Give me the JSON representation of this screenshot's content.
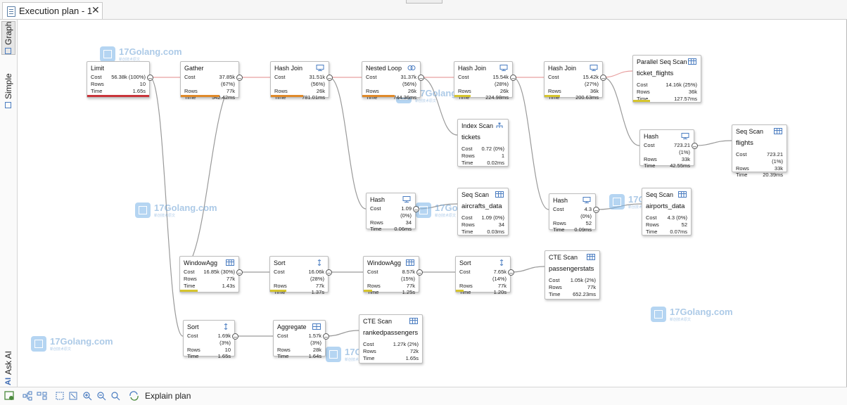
{
  "tab": {
    "title": "Execution plan - 1",
    "close": "✕"
  },
  "sidebar": {
    "graph_label": "Graph",
    "simple_label": "Simple",
    "ask_ai_label": "Ask AI",
    "ai_glyph": "AI"
  },
  "toolbar": {
    "explain_label": "Explain plan"
  },
  "labels": {
    "cost": "Cost",
    "rows": "Rows",
    "time": "Time",
    "collapse": "–"
  },
  "watermark": {
    "text": "17Golang.com",
    "sub": "新创技术原文"
  },
  "colors": {
    "accent": "#4a7cc0",
    "edge_hot": "#e8a0a0",
    "edge": "#9a9a9a",
    "bar_red": "#c9343a",
    "bar_orange": "#e08a2a",
    "bar_yellow": "#d6c52e"
  },
  "nodes": [
    {
      "id": "limit",
      "title": "Limit",
      "sub": "",
      "icon": "",
      "cost": "56.38k (100%)",
      "rows": "10",
      "time": "1.65s",
      "bar": "red",
      "barpct": 1.0
    },
    {
      "id": "gather",
      "title": "Gather",
      "sub": "",
      "icon": "",
      "cost": "37.85k (67%)",
      "rows": "77k",
      "time": "542.42ms",
      "bar": "orange",
      "barpct": 0.67
    },
    {
      "id": "hj1",
      "title": "Hash Join",
      "sub": "",
      "icon": "hash-join-icon",
      "cost": "31.51k (56%)",
      "rows": "26k",
      "time": "781.01ms",
      "bar": "orange",
      "barpct": 0.56
    },
    {
      "id": "nl",
      "title": "Nested Loop",
      "sub": "",
      "icon": "nested-loop-icon",
      "cost": "31.37k (56%)",
      "rows": "26k",
      "time": "744.36ms",
      "bar": "orange",
      "barpct": 0.56
    },
    {
      "id": "hj2",
      "title": "Hash Join",
      "sub": "",
      "icon": "hash-join-icon",
      "cost": "15.54k (28%)",
      "rows": "26k",
      "time": "224.98ms",
      "bar": "yellow",
      "barpct": 0.28
    },
    {
      "id": "hj3",
      "title": "Hash Join",
      "sub": "",
      "icon": "hash-join-icon",
      "cost": "15.42k (27%)",
      "rows": "36k",
      "time": "200.63ms",
      "bar": "yellow",
      "barpct": 0.27
    },
    {
      "id": "pss",
      "title": "Parallel Seq Scan",
      "sub": "ticket_flights",
      "icon": "table-icon",
      "cost": "14.16k (25%)",
      "rows": "36k",
      "time": "127.57ms",
      "bar": "yellow",
      "barpct": 0.25
    },
    {
      "id": "is",
      "title": "Index Scan",
      "sub": "tickets",
      "icon": "index-icon",
      "cost": "0.72 (0%)",
      "rows": "1",
      "time": "0.02ms",
      "bar": "",
      "barpct": 0
    },
    {
      "id": "hash1",
      "title": "Hash",
      "sub": "",
      "icon": "hash-icon",
      "cost": "723.21 (1%)",
      "rows": "33k",
      "time": "42.55ms",
      "bar": "",
      "barpct": 0
    },
    {
      "id": "ss_fl",
      "title": "Seq Scan",
      "sub": "flights",
      "icon": "table-icon",
      "cost": "723.21 (1%)",
      "rows": "33k",
      "time": "20.39ms",
      "bar": "",
      "barpct": 0
    },
    {
      "id": "hash2",
      "title": "Hash",
      "sub": "",
      "icon": "hash-icon",
      "cost": "1.09 (0%)",
      "rows": "34",
      "time": "0.06ms",
      "bar": "",
      "barpct": 0
    },
    {
      "id": "ss_ac",
      "title": "Seq Scan",
      "sub": "aircrafts_data",
      "icon": "table-icon",
      "cost": "1.09 (0%)",
      "rows": "34",
      "time": "0.03ms",
      "bar": "",
      "barpct": 0
    },
    {
      "id": "hash3",
      "title": "Hash",
      "sub": "",
      "icon": "hash-icon",
      "cost": "4.3 (0%)",
      "rows": "52",
      "time": "0.09ms",
      "bar": "",
      "barpct": 0
    },
    {
      "id": "ss_ap",
      "title": "Seq Scan",
      "sub": "airports_data",
      "icon": "table-icon",
      "cost": "4.3 (0%)",
      "rows": "52",
      "time": "0.07ms",
      "bar": "",
      "barpct": 0
    },
    {
      "id": "wa1",
      "title": "WindowAgg",
      "sub": "",
      "icon": "table-icon",
      "cost": "16.85k (30%)",
      "rows": "77k",
      "time": "1.43s",
      "bar": "yellow",
      "barpct": 0.3
    },
    {
      "id": "sort1",
      "title": "Sort",
      "sub": "",
      "icon": "sort-icon",
      "cost": "16.06k (28%)",
      "rows": "77k",
      "time": "1.37s",
      "bar": "yellow",
      "barpct": 0.28
    },
    {
      "id": "wa2",
      "title": "WindowAgg",
      "sub": "",
      "icon": "table-icon",
      "cost": "8.57k (15%)",
      "rows": "77k",
      "time": "1.25s",
      "bar": "yellow",
      "barpct": 0.15
    },
    {
      "id": "sort2",
      "title": "Sort",
      "sub": "",
      "icon": "sort-icon",
      "cost": "7.65k (14%)",
      "rows": "77k",
      "time": "1.20s",
      "bar": "yellow",
      "barpct": 0.14
    },
    {
      "id": "cte1",
      "title": "CTE Scan",
      "sub": "passengerstats",
      "icon": "table-icon",
      "cost": "1.05k (2%)",
      "rows": "77k",
      "time": "652.23ms",
      "bar": "",
      "barpct": 0
    },
    {
      "id": "sort3",
      "title": "Sort",
      "sub": "",
      "icon": "sort-icon",
      "cost": "1.69k (3%)",
      "rows": "10",
      "time": "1.65s",
      "bar": "",
      "barpct": 0
    },
    {
      "id": "agg",
      "title": "Aggregate",
      "sub": "",
      "icon": "aggregate-icon",
      "cost": "1.57k (3%)",
      "rows": "28k",
      "time": "1.64s",
      "bar": "",
      "barpct": 0
    },
    {
      "id": "cte2",
      "title": "CTE Scan",
      "sub": "rankedpassengers",
      "icon": "table-icon",
      "cost": "1.27k (2%)",
      "rows": "72k",
      "time": "1.65s",
      "bar": "",
      "barpct": 0
    }
  ]
}
